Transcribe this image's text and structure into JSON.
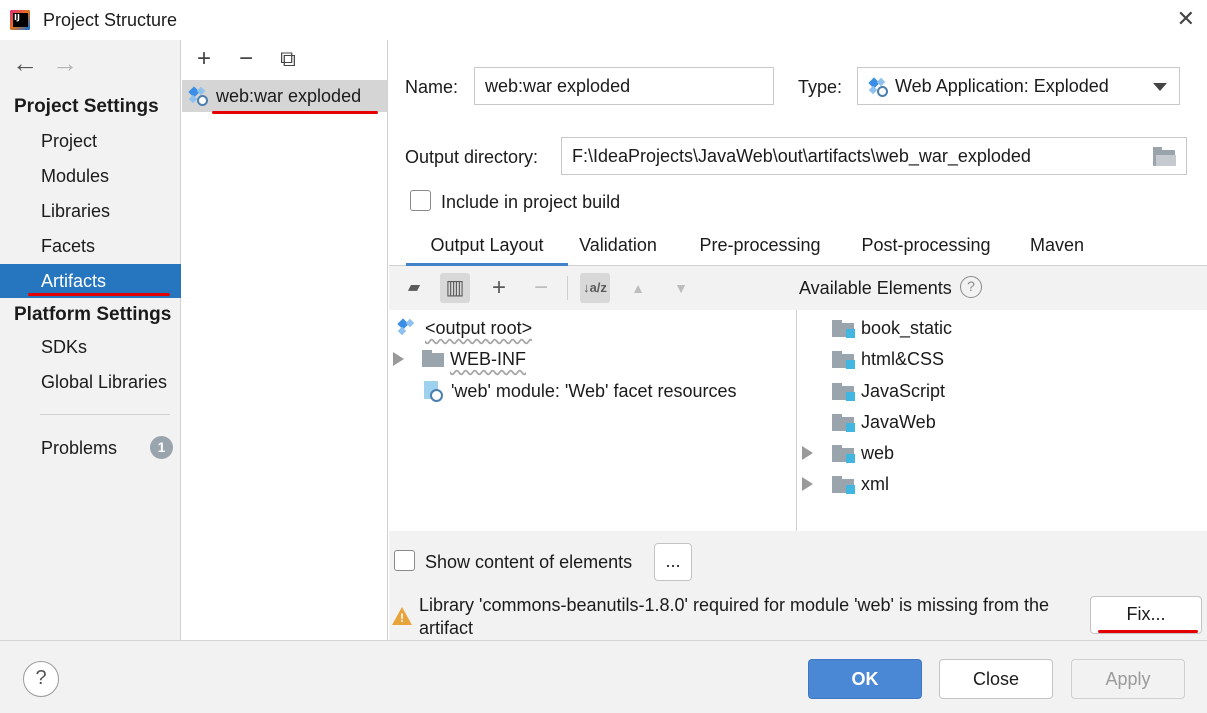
{
  "window": {
    "title": "Project Structure",
    "close_glyph": "✕"
  },
  "nav": {
    "back_glyph": "←",
    "forward_glyph": "→",
    "project_settings_header": "Project Settings",
    "project_settings_items": [
      "Project",
      "Modules",
      "Libraries",
      "Facets",
      "Artifacts"
    ],
    "platform_settings_header": "Platform Settings",
    "platform_settings_items": [
      "SDKs",
      "Global Libraries"
    ],
    "problems_label": "Problems",
    "problems_count": "1",
    "selected_item": "Artifacts"
  },
  "artifacts": {
    "toolbar": {
      "add_glyph": "+",
      "remove_glyph": "−",
      "copy_glyph": "⧉"
    },
    "items": [
      "web:war exploded"
    ]
  },
  "artifact_config": {
    "name_label": "Name:",
    "name_value": "web:war exploded",
    "type_label": "Type:",
    "type_value": "Web Application: Exploded",
    "output_dir_label": "Output directory:",
    "output_dir_value": "F:\\IdeaProjects\\JavaWeb\\out\\artifacts\\web_war_exploded",
    "include_in_build_label": "Include in project build",
    "include_in_build_checked": false
  },
  "tabs": [
    "Output Layout",
    "Validation",
    "Pre-processing",
    "Post-processing",
    "Maven"
  ],
  "active_tab": "Output Layout",
  "layout_toolbar": {
    "new_dir_glyph": "▰",
    "archive_glyph": "▥",
    "add_glyph": "+",
    "remove_glyph": "−",
    "sort_glyph": "↓a/z",
    "up_glyph": "▲",
    "down_glyph": "▼"
  },
  "output_tree": {
    "root": "<output root>",
    "webinf": "WEB-INF",
    "resource": "'web' module: 'Web' facet resources"
  },
  "available_elements": {
    "label": "Available Elements",
    "help_glyph": "?",
    "items": [
      {
        "name": "book_static",
        "expandable": false
      },
      {
        "name": "html&CSS",
        "expandable": false
      },
      {
        "name": "JavaScript",
        "expandable": false
      },
      {
        "name": "JavaWeb",
        "expandable": false
      },
      {
        "name": "web",
        "expandable": true
      },
      {
        "name": "xml",
        "expandable": true
      }
    ]
  },
  "footer": {
    "show_content_label": "Show content of elements",
    "show_content_checked": false,
    "ellipsis_button": "...",
    "warning_text": "Library 'commons-beanutils-1.8.0' required for module 'web' is missing from the artifact",
    "fix_button": "Fix..."
  },
  "buttons": {
    "help": "?",
    "ok": "OK",
    "close": "Close",
    "apply": "Apply"
  },
  "colors": {
    "selection": "#2675bf",
    "primary_button": "#4a87d4",
    "annotation_red": "#e50000",
    "warning": "#e8a33a"
  }
}
